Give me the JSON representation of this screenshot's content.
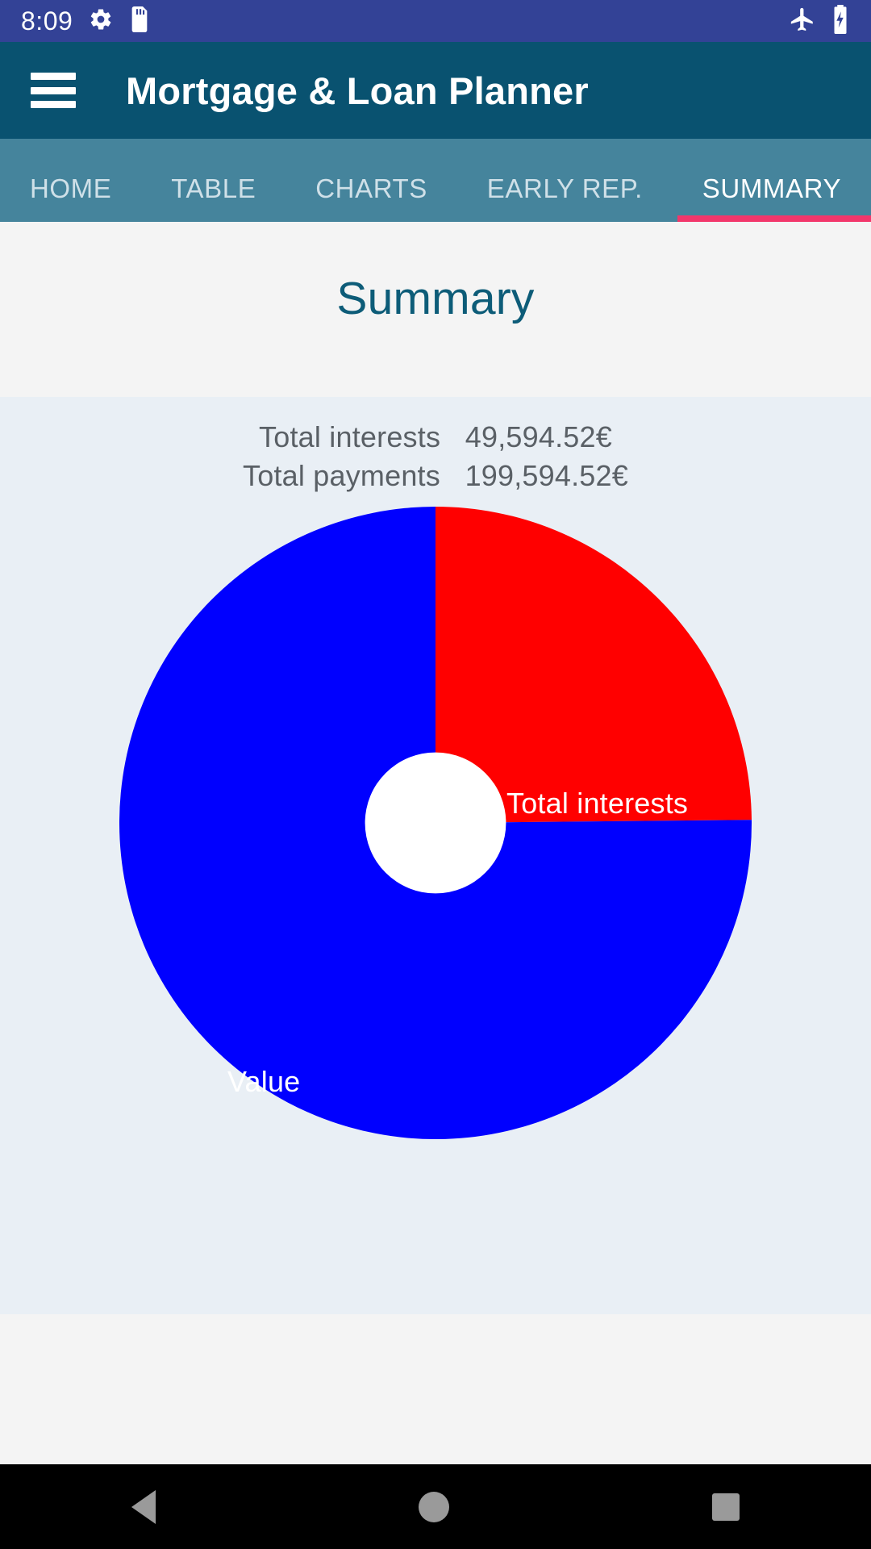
{
  "status_bar": {
    "time": "8:09",
    "left_icons": [
      "gear-icon",
      "sd-card-icon"
    ],
    "right_icons": [
      "airplane-mode-icon",
      "battery-charging-icon"
    ],
    "background_color": "#334296"
  },
  "app_bar": {
    "menu_icon": "hamburger-menu-icon",
    "title": "Mortgage & Loan Planner",
    "background_color": "#095270"
  },
  "tabs": {
    "items": [
      {
        "label": "HOME",
        "active": false
      },
      {
        "label": "TABLE",
        "active": false
      },
      {
        "label": "CHARTS",
        "active": false
      },
      {
        "label": "EARLY REP.",
        "active": false
      },
      {
        "label": "SUMMARY",
        "active": true
      }
    ],
    "background_color": "#45849c",
    "indicator_color": "#f2376b"
  },
  "main": {
    "page_title": "Summary",
    "page_title_color": "#0d5c78",
    "card_background": "#e9eff5",
    "totals": [
      {
        "label": "Total interests",
        "value": "49,594.52€"
      },
      {
        "label": "Total payments",
        "value": "199,594.52€"
      }
    ]
  },
  "chart_data": {
    "type": "pie",
    "title": "Summary",
    "donut": true,
    "inner_radius_ratio": 0.223,
    "start_angle": 0,
    "labels": [
      "Total interests",
      "Value"
    ],
    "values": [
      49594.52,
      150000.0
    ],
    "percentages": [
      24.85,
      75.15
    ],
    "colors": [
      "#ff0000",
      "#0000ff"
    ],
    "label_color": "#ffffff",
    "currency": "€",
    "total": 199594.52,
    "legend": "none",
    "grid": false
  },
  "nav_bar": {
    "buttons": [
      "back-button",
      "home-button",
      "recents-button"
    ],
    "background_color": "#000000",
    "icon_color": "#9a9a9a"
  }
}
